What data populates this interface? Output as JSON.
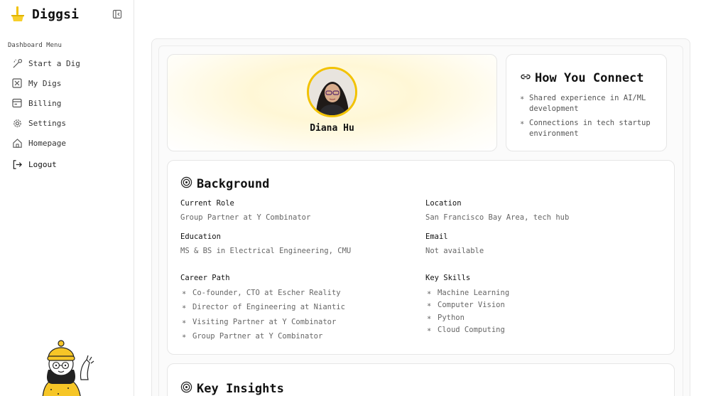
{
  "app": {
    "name": "Diggsi"
  },
  "sidebar": {
    "menu_title": "Dashboard Menu",
    "items": [
      {
        "label": "Start a Dig",
        "icon": "wand-icon"
      },
      {
        "label": "My Digs",
        "icon": "box-x-icon"
      },
      {
        "label": "Billing",
        "icon": "receipt-icon"
      },
      {
        "label": "Settings",
        "icon": "gear-icon"
      },
      {
        "label": "Homepage",
        "icon": "home-icon"
      }
    ],
    "logout_label": "Logout"
  },
  "profile": {
    "name": "Diana Hu"
  },
  "connect": {
    "title": "How You Connect",
    "items": [
      "Shared experience in AI/ML development",
      "Connections in tech startup environment"
    ]
  },
  "background": {
    "title": "Background",
    "current_role_label": "Current Role",
    "current_role": "Group Partner at Y Combinator",
    "location_label": "Location",
    "location": "San Francisco Bay Area, tech hub",
    "education_label": "Education",
    "education": "MS & BS in Electrical Engineering, CMU",
    "email_label": "Email",
    "email": "Not available",
    "career_label": "Career Path",
    "career": [
      "Co-founder, CTO at Escher Reality",
      "Director of Engineering at Niantic",
      "Visiting Partner at Y Combinator",
      "Group Partner at Y Combinator"
    ],
    "skills_label": "Key Skills",
    "skills": [
      "Machine Learning",
      "Computer Vision",
      "Python",
      "Cloud Computing"
    ]
  },
  "insights": {
    "title": "Key Insights"
  },
  "colors": {
    "accent": "#f2c200",
    "border": "#e6e6e6",
    "muted_text": "#666666"
  }
}
